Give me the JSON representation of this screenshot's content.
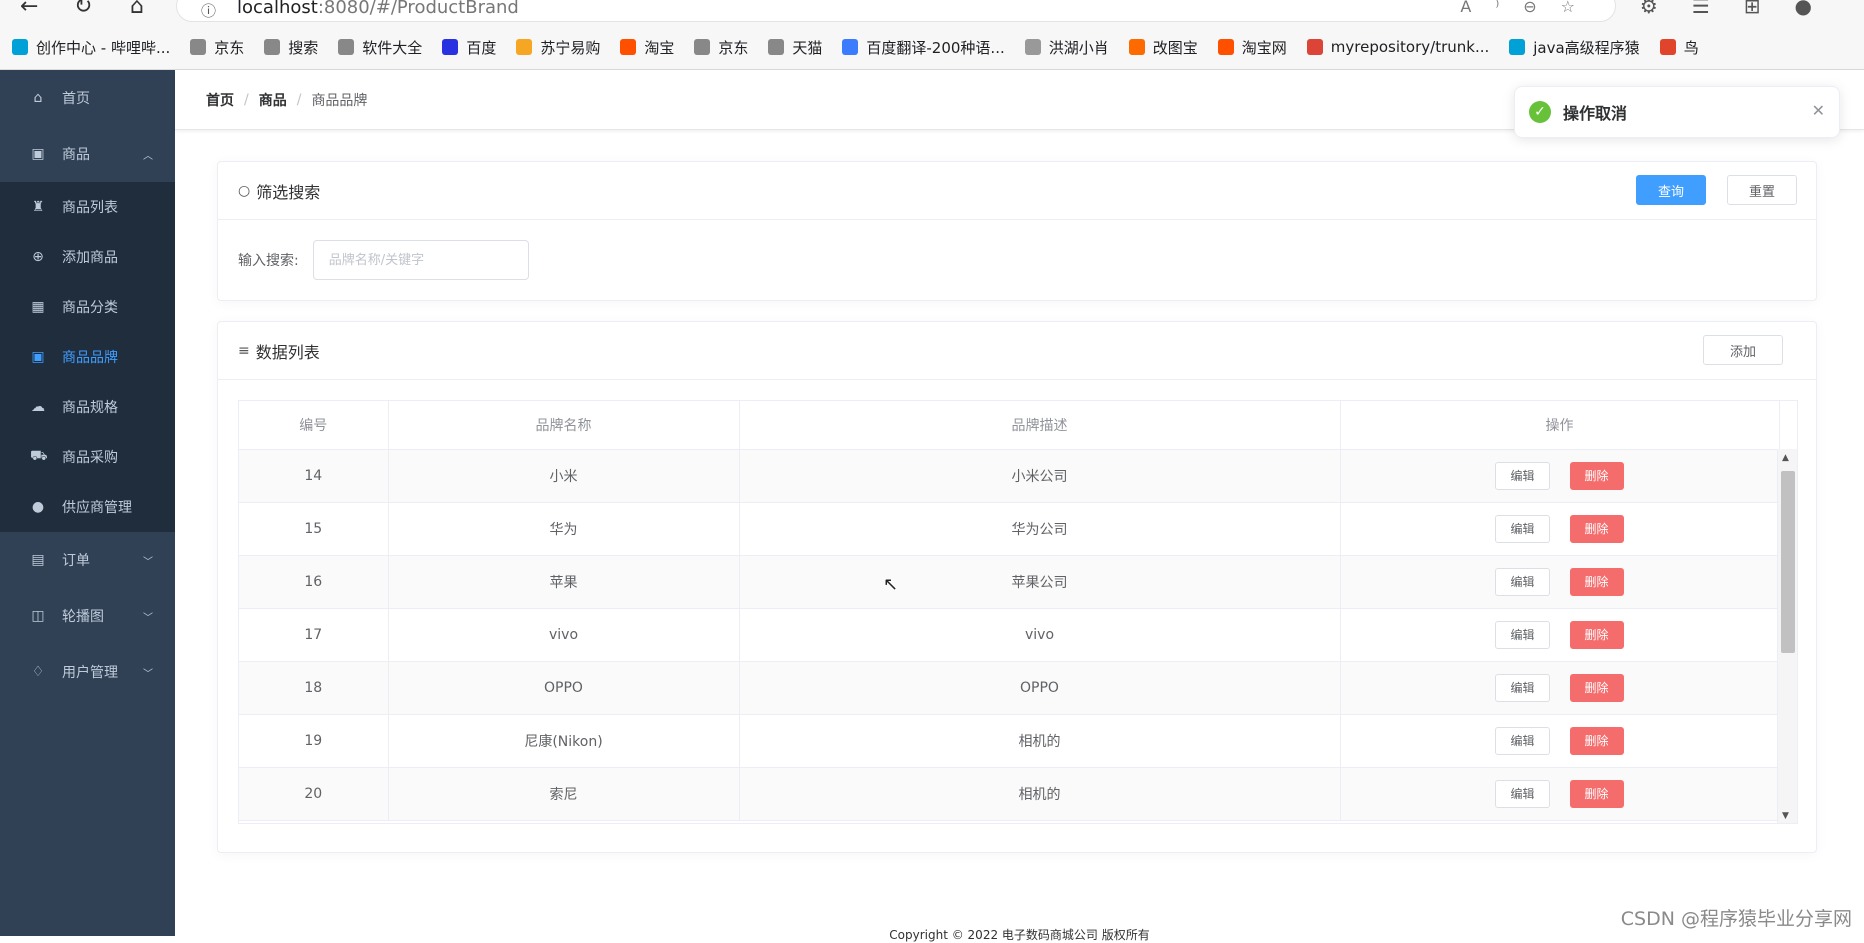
{
  "browser": {
    "url_host": "localhost",
    "url_rest": ":8080/#/ProductBrand",
    "bookmarks": [
      {
        "label": "创作中心 - 哔哩哔...",
        "icon": "bilibili-icon",
        "color": "#00a1d6"
      },
      {
        "label": "京东",
        "icon": "page-icon",
        "color": "#888888"
      },
      {
        "label": "搜索",
        "icon": "page-icon",
        "color": "#888888"
      },
      {
        "label": "软件大全",
        "icon": "page-icon",
        "color": "#888888"
      },
      {
        "label": "百度",
        "icon": "baidu-icon",
        "color": "#2932e1"
      },
      {
        "label": "苏宁易购",
        "icon": "suning-icon",
        "color": "#f5a623"
      },
      {
        "label": "淘宝",
        "icon": "taobao-icon",
        "color": "#ff5000"
      },
      {
        "label": "京东",
        "icon": "page-icon",
        "color": "#888888"
      },
      {
        "label": "天猫",
        "icon": "page-icon",
        "color": "#888888"
      },
      {
        "label": "百度翻译-200种语...",
        "icon": "translate-icon",
        "color": "#3b7cff"
      },
      {
        "label": "洪湖小肖",
        "icon": "avatar-icon",
        "color": "#999999"
      },
      {
        "label": "改图宝",
        "icon": "gaitubao-icon",
        "color": "#ff6a00"
      },
      {
        "label": "淘宝网",
        "icon": "taobao-icon",
        "color": "#ff5000"
      },
      {
        "label": "myrepository/trunk...",
        "icon": "chrome-icon",
        "color": "#db4437"
      },
      {
        "label": "java高级程序猿",
        "icon": "bilibili-icon",
        "color": "#00a1d6"
      },
      {
        "label": "鸟",
        "icon": "bird-icon",
        "color": "#e0452b"
      }
    ]
  },
  "sidebar": {
    "home": "首页",
    "goods": "商品",
    "goods_items": [
      {
        "label": "商品列表",
        "icon": "trash-bag-icon"
      },
      {
        "label": "添加商品",
        "icon": "plus-circle-icon"
      },
      {
        "label": "商品分类",
        "icon": "grid-icon"
      },
      {
        "label": "商品品牌",
        "icon": "badge-icon",
        "active": true
      },
      {
        "label": "商品规格",
        "icon": "cloud-icon"
      },
      {
        "label": "商品采购",
        "icon": "truck-icon"
      },
      {
        "label": "供应商管理",
        "icon": "user-icon"
      }
    ],
    "orders": "订单",
    "carousel": "轮播图",
    "users": "用户管理"
  },
  "breadcrumb": {
    "home": "首页",
    "goods": "商品",
    "current": "商品品牌"
  },
  "toast": {
    "message": "操作取消",
    "type": "success"
  },
  "filter": {
    "title": "筛选搜索",
    "query_btn": "查询",
    "reset_btn": "重置",
    "input_label": "输入搜索:",
    "input_placeholder": "品牌名称/关键字",
    "input_value": ""
  },
  "list": {
    "title": "数据列表",
    "add_btn": "添加",
    "columns": [
      "编号",
      "品牌名称",
      "品牌描述",
      "操作"
    ],
    "edit_label": "编辑",
    "delete_label": "删除",
    "rows": [
      {
        "id": "14",
        "name": "小米",
        "desc": "小米公司"
      },
      {
        "id": "15",
        "name": "华为",
        "desc": "华为公司"
      },
      {
        "id": "16",
        "name": "苹果",
        "desc": "苹果公司"
      },
      {
        "id": "17",
        "name": "vivo",
        "desc": "vivo"
      },
      {
        "id": "18",
        "name": "OPPO",
        "desc": "OPPO"
      },
      {
        "id": "19",
        "name": "尼康(Nikon)",
        "desc": "相机的"
      },
      {
        "id": "20",
        "name": "索尼",
        "desc": "相机的"
      }
    ]
  },
  "footer": "Copyright © 2022 电子数码商城公司 版权所有",
  "watermark": "CSDN @程序猿毕业分享网",
  "colors": {
    "sidebar": "#304156",
    "submenu": "#1f2d3d",
    "primary": "#409eff",
    "danger": "#f56c6c",
    "success": "#67c23a"
  }
}
